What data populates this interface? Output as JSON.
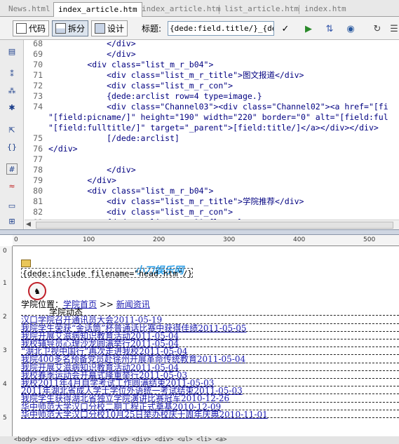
{
  "tabs": [
    {
      "label": "News.html",
      "active": false
    },
    {
      "label": "index_article.htm",
      "active": true
    },
    {
      "label": "index_article.htm",
      "active": false
    },
    {
      "label": "list_article.htm",
      "active": false
    },
    {
      "label": "index.htm",
      "active": false
    }
  ],
  "toolbar": {
    "code_label": "代码",
    "split_label": "拆分",
    "design_label": "设计",
    "title_label": "标题:",
    "title_value": "{dede:field.title/}_{dede"
  },
  "code": {
    "lines": [
      {
        "num": "68",
        "text": "            </div>"
      },
      {
        "num": "69",
        "text": "            </div>"
      },
      {
        "num": "70",
        "text": "        <div class=\"list_m_r_b04\">"
      },
      {
        "num": "71",
        "text": "            <div class=\"list_m_r_title\">图文报道</div>"
      },
      {
        "num": "72",
        "text": "            <div class=\"list_m_r_con\">"
      },
      {
        "num": "73",
        "text": "            {dede:arclist row=4 type=image.}"
      },
      {
        "num": "74",
        "text": "            <div class=\"Channel03\"><div class=\"Channel02\"><a href=\"[fi"
      },
      {
        "num": "",
        "text": "\"[field:picname/]\" height=\"190\" width=\"220\" border=\"0\" alt=\"[field:ful"
      },
      {
        "num": "",
        "text": "\"[field:fulltitle/]\" target=\"_parent\">[field:title/]</a></div></div>"
      },
      {
        "num": "75",
        "text": "            [/dede:arclist]"
      },
      {
        "num": "76",
        "text": "</div>"
      },
      {
        "num": "77",
        "text": ""
      },
      {
        "num": "78",
        "text": "            </div>"
      },
      {
        "num": "79",
        "text": "        </div>"
      },
      {
        "num": "80",
        "text": "        <div class=\"list_m_r_b04\">"
      },
      {
        "num": "81",
        "text": "            <div class=\"list_m_r_title\">学院推荐</div>"
      },
      {
        "num": "82",
        "text": "            <div class=\"list_m_r_con\">"
      },
      {
        "num": "83",
        "text": "            {dede:arclist row=10 flag=c}"
      }
    ]
  },
  "design": {
    "ruler_top": [
      "0",
      "100",
      "200",
      "300",
      "400",
      "500"
    ],
    "ruler_left": [
      "0",
      "1",
      "2",
      "3",
      "4",
      "5"
    ],
    "watermark": "小刀娱乐网",
    "include_text": "{dede:include filename=\"head.htm\"/}",
    "breadcrumb": [
      "学院位置：",
      "学院首页",
      " >> ",
      "新闻资讯"
    ],
    "section_heading": "学院动态",
    "news": [
      "汉口学院召开通讯员大会2011-05-19",
      "我院学生荣获“金话筒”杯普通话比赛中获得佳绩2011-05-05",
      "我院开展艾滋病知识教育活动2011-05-04",
      "我校辅导员心理沙龙圆满举行2011-05-04",
      "“湖北卫视中国行”再次走进我校2011-05-04",
      "我院400多名预备党员赴徐州开展革命传统教育2011-05-04",
      "我院开展艾滋病知识教育活动2011-05-04",
      "我校春季运动会开幕式隆重举行2011-05-03",
      "我校2011年4月自学考试工作圆满结束2011-05-03",
      "2011年湖北省成人学士学位外语统一考试结束2011-05-03",
      "我院学生获得湖北省独立学院演讲比赛冠军2010-12-26",
      "华中师范大学汉口分校二期工程正式奠基2010-12-09",
      "华中师范大学汉口分校10月25日举办校庆十周年庆典2010-11-01"
    ],
    "status_text": "<body> <div> <div> <div> <div> <div> <div> <ul> <li> <a>"
  },
  "colors": {
    "link": "#1a1ab0",
    "watermark": "#2fa0e8",
    "code_tag": "#000080",
    "code_string": "#0000ff"
  }
}
